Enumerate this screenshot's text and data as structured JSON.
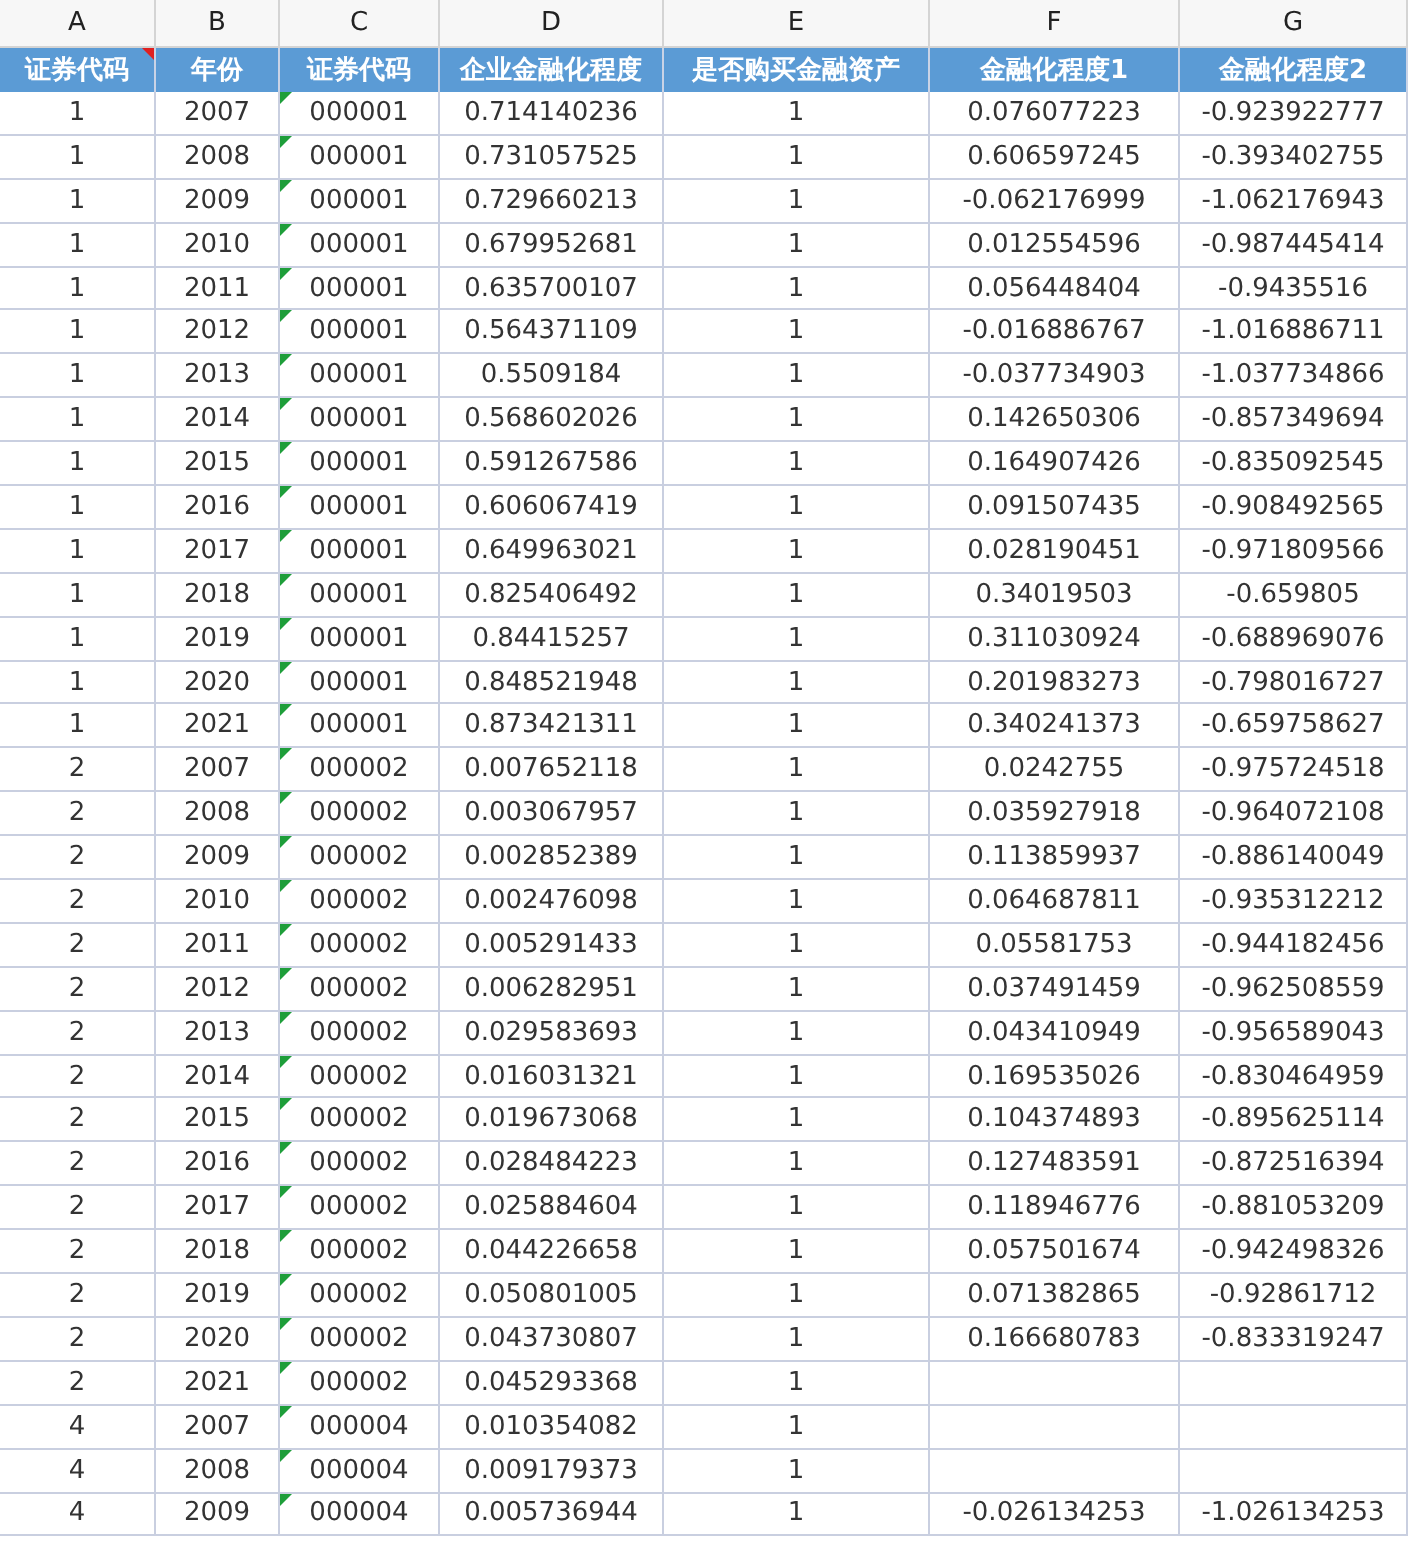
{
  "column_letters": [
    "A",
    "B",
    "C",
    "D",
    "E",
    "F",
    "G"
  ],
  "headers": [
    {
      "label": "证券代码",
      "comment": true
    },
    {
      "label": "年份",
      "comment": false
    },
    {
      "label": "证券代码",
      "comment": false
    },
    {
      "label": "企业金融化程度",
      "comment": false
    },
    {
      "label": "是否购买金融资产",
      "comment": false
    },
    {
      "label": "金融化程度1",
      "comment": false
    },
    {
      "label": "金融化程度2",
      "comment": false
    }
  ],
  "rows": [
    {
      "cells": [
        "1",
        "2007",
        "000001",
        "0.714140236",
        "1",
        "0.076077223",
        "-0.923922777"
      ],
      "code_as_text": true
    },
    {
      "cells": [
        "1",
        "2008",
        "000001",
        "0.731057525",
        "1",
        "0.606597245",
        "-0.393402755"
      ],
      "code_as_text": true
    },
    {
      "cells": [
        "1",
        "2009",
        "000001",
        "0.729660213",
        "1",
        "-0.062176999",
        "-1.062176943"
      ],
      "code_as_text": true
    },
    {
      "cells": [
        "1",
        "2010",
        "000001",
        "0.679952681",
        "1",
        "0.012554596",
        "-0.987445414"
      ],
      "code_as_text": true
    },
    {
      "cells": [
        "1",
        "2011",
        "000001",
        "0.635700107",
        "1",
        "0.056448404",
        "-0.9435516"
      ],
      "code_as_text": true
    },
    {
      "cells": [
        "1",
        "2012",
        "000001",
        "0.564371109",
        "1",
        "-0.016886767",
        "-1.016886711"
      ],
      "code_as_text": true
    },
    {
      "cells": [
        "1",
        "2013",
        "000001",
        "0.5509184",
        "1",
        "-0.037734903",
        "-1.037734866"
      ],
      "code_as_text": true
    },
    {
      "cells": [
        "1",
        "2014",
        "000001",
        "0.568602026",
        "1",
        "0.142650306",
        "-0.857349694"
      ],
      "code_as_text": true
    },
    {
      "cells": [
        "1",
        "2015",
        "000001",
        "0.591267586",
        "1",
        "0.164907426",
        "-0.835092545"
      ],
      "code_as_text": true
    },
    {
      "cells": [
        "1",
        "2016",
        "000001",
        "0.606067419",
        "1",
        "0.091507435",
        "-0.908492565"
      ],
      "code_as_text": true
    },
    {
      "cells": [
        "1",
        "2017",
        "000001",
        "0.649963021",
        "1",
        "0.028190451",
        "-0.971809566"
      ],
      "code_as_text": true
    },
    {
      "cells": [
        "1",
        "2018",
        "000001",
        "0.825406492",
        "1",
        "0.34019503",
        "-0.659805"
      ],
      "code_as_text": true
    },
    {
      "cells": [
        "1",
        "2019",
        "000001",
        "0.84415257",
        "1",
        "0.311030924",
        "-0.688969076"
      ],
      "code_as_text": true
    },
    {
      "cells": [
        "1",
        "2020",
        "000001",
        "0.848521948",
        "1",
        "0.201983273",
        "-0.798016727"
      ],
      "code_as_text": true
    },
    {
      "cells": [
        "1",
        "2021",
        "000001",
        "0.873421311",
        "1",
        "0.340241373",
        "-0.659758627"
      ],
      "code_as_text": true
    },
    {
      "cells": [
        "2",
        "2007",
        "000002",
        "0.007652118",
        "1",
        "0.0242755",
        "-0.975724518"
      ],
      "code_as_text": true
    },
    {
      "cells": [
        "2",
        "2008",
        "000002",
        "0.003067957",
        "1",
        "0.035927918",
        "-0.964072108"
      ],
      "code_as_text": true
    },
    {
      "cells": [
        "2",
        "2009",
        "000002",
        "0.002852389",
        "1",
        "0.113859937",
        "-0.886140049"
      ],
      "code_as_text": true
    },
    {
      "cells": [
        "2",
        "2010",
        "000002",
        "0.002476098",
        "1",
        "0.064687811",
        "-0.935312212"
      ],
      "code_as_text": true
    },
    {
      "cells": [
        "2",
        "2011",
        "000002",
        "0.005291433",
        "1",
        "0.05581753",
        "-0.944182456"
      ],
      "code_as_text": true
    },
    {
      "cells": [
        "2",
        "2012",
        "000002",
        "0.006282951",
        "1",
        "0.037491459",
        "-0.962508559"
      ],
      "code_as_text": true
    },
    {
      "cells": [
        "2",
        "2013",
        "000002",
        "0.029583693",
        "1",
        "0.043410949",
        "-0.956589043"
      ],
      "code_as_text": true
    },
    {
      "cells": [
        "2",
        "2014",
        "000002",
        "0.016031321",
        "1",
        "0.169535026",
        "-0.830464959"
      ],
      "code_as_text": true
    },
    {
      "cells": [
        "2",
        "2015",
        "000002",
        "0.019673068",
        "1",
        "0.104374893",
        "-0.895625114"
      ],
      "code_as_text": true
    },
    {
      "cells": [
        "2",
        "2016",
        "000002",
        "0.028484223",
        "1",
        "0.127483591",
        "-0.872516394"
      ],
      "code_as_text": true
    },
    {
      "cells": [
        "2",
        "2017",
        "000002",
        "0.025884604",
        "1",
        "0.118946776",
        "-0.881053209"
      ],
      "code_as_text": true
    },
    {
      "cells": [
        "2",
        "2018",
        "000002",
        "0.044226658",
        "1",
        "0.057501674",
        "-0.942498326"
      ],
      "code_as_text": true
    },
    {
      "cells": [
        "2",
        "2019",
        "000002",
        "0.050801005",
        "1",
        "0.071382865",
        "-0.92861712"
      ],
      "code_as_text": true
    },
    {
      "cells": [
        "2",
        "2020",
        "000002",
        "0.043730807",
        "1",
        "0.166680783",
        "-0.833319247"
      ],
      "code_as_text": true
    },
    {
      "cells": [
        "2",
        "2021",
        "000002",
        "0.045293368",
        "1"
      ],
      "code_as_text": true
    },
    {
      "cells": [
        "4",
        "2007",
        "000004",
        "0.010354082",
        "1"
      ],
      "code_as_text": true
    },
    {
      "cells": [
        "4",
        "2008",
        "000004",
        "0.009179373",
        "1"
      ],
      "code_as_text": true
    },
    {
      "cells": [
        "4",
        "2009",
        "000004",
        "0.005736944",
        "1",
        "-0.026134253",
        "-1.026134253"
      ],
      "code_as_text": true
    }
  ]
}
